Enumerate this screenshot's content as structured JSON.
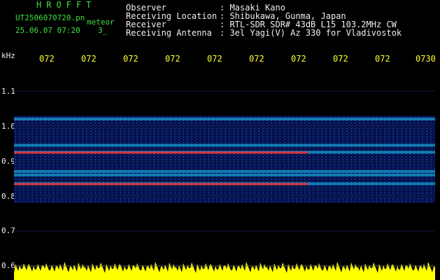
{
  "header": {
    "title": "HROFFT",
    "filename": "UT2506070720.pn",
    "meteor_label": "meteor",
    "datetime": "25.06.07 07:20",
    "count": "3_"
  },
  "info": [
    {
      "key": "Observer",
      "value": ": Masaki Kano"
    },
    {
      "key": "Receiving Location",
      "value": ": Shibukawa, Gunma, Japan"
    },
    {
      "key": "Receiver",
      "value": ": RTL-SDR SDR# 43dB L15 103.2MHz CW"
    },
    {
      "key": "Receiving Antenna",
      "value": ": 3el Yagi(V) Az 330 for Vladivostok"
    }
  ],
  "axis": {
    "unit": "kHz",
    "y_ticks": [
      "1.1",
      "1.0",
      "0.9",
      "0.8",
      "0.7",
      "0.6"
    ],
    "x_ticks": [
      "072",
      "072",
      "072",
      "072",
      "072",
      "072",
      "072",
      "072",
      "072",
      "0730"
    ]
  },
  "chart_data": {
    "type": "heatmap",
    "ylabel": "kHz",
    "ylim": [
      0.6,
      1.1
    ],
    "bands_khz": [
      0.835,
      0.86,
      0.87,
      0.925,
      0.945,
      1.02
    ],
    "background_noise_range_khz": [
      0.78,
      1.03
    ],
    "colors": {
      "background": "#000000",
      "noise": "#0a28c8",
      "band_mid": "#1ecfff",
      "band_hot": "#ff2a2a",
      "strip": "#ffff00"
    }
  }
}
